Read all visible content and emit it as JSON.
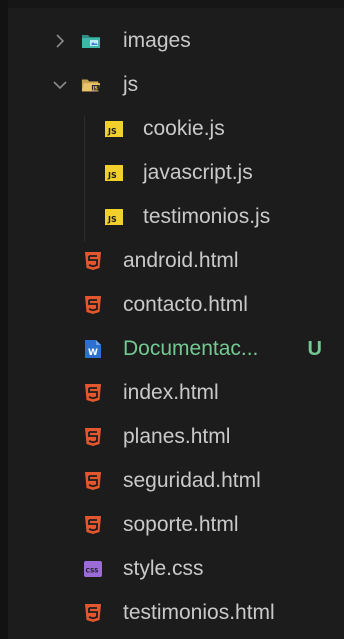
{
  "explorer": {
    "items": [
      {
        "label": "images",
        "kind": "folder",
        "state": "collapsed",
        "icon": "images-folder-icon",
        "color": "#3fb7a8"
      },
      {
        "label": "js",
        "kind": "folder",
        "state": "expanded",
        "icon": "js-folder-icon",
        "color": "#e8c46b"
      },
      {
        "label": "cookie.js",
        "kind": "file",
        "icon": "js-file-icon",
        "color": "#f1d02b",
        "icon_text": "JS"
      },
      {
        "label": "javascript.js",
        "kind": "file",
        "icon": "js-file-icon",
        "color": "#f1d02b",
        "icon_text": "JS"
      },
      {
        "label": "testimonios.js",
        "kind": "file",
        "icon": "js-file-icon",
        "color": "#f1d02b",
        "icon_text": "JS"
      },
      {
        "label": "android.html",
        "kind": "file",
        "icon": "html5-icon",
        "color": "#e4572e"
      },
      {
        "label": "contacto.html",
        "kind": "file",
        "icon": "html5-icon",
        "color": "#e4572e"
      },
      {
        "label": "Documentac...",
        "kind": "file",
        "icon": "word-document-icon",
        "color": "#2b6fd1",
        "icon_text": "W",
        "badge": "U"
      },
      {
        "label": "index.html",
        "kind": "file",
        "icon": "html5-icon",
        "color": "#e4572e"
      },
      {
        "label": "planes.html",
        "kind": "file",
        "icon": "html5-icon",
        "color": "#e4572e"
      },
      {
        "label": "seguridad.html",
        "kind": "file",
        "icon": "html5-icon",
        "color": "#e4572e"
      },
      {
        "label": "soporte.html",
        "kind": "file",
        "icon": "html5-icon",
        "color": "#e4572e"
      },
      {
        "label": "style.css",
        "kind": "file",
        "icon": "css-file-icon",
        "color": "#9b6cd6",
        "icon_text": "CSS"
      },
      {
        "label": "testimonios.html",
        "kind": "file",
        "icon": "html5-icon",
        "color": "#e4572e"
      }
    ],
    "modified_color": "#73c991"
  }
}
